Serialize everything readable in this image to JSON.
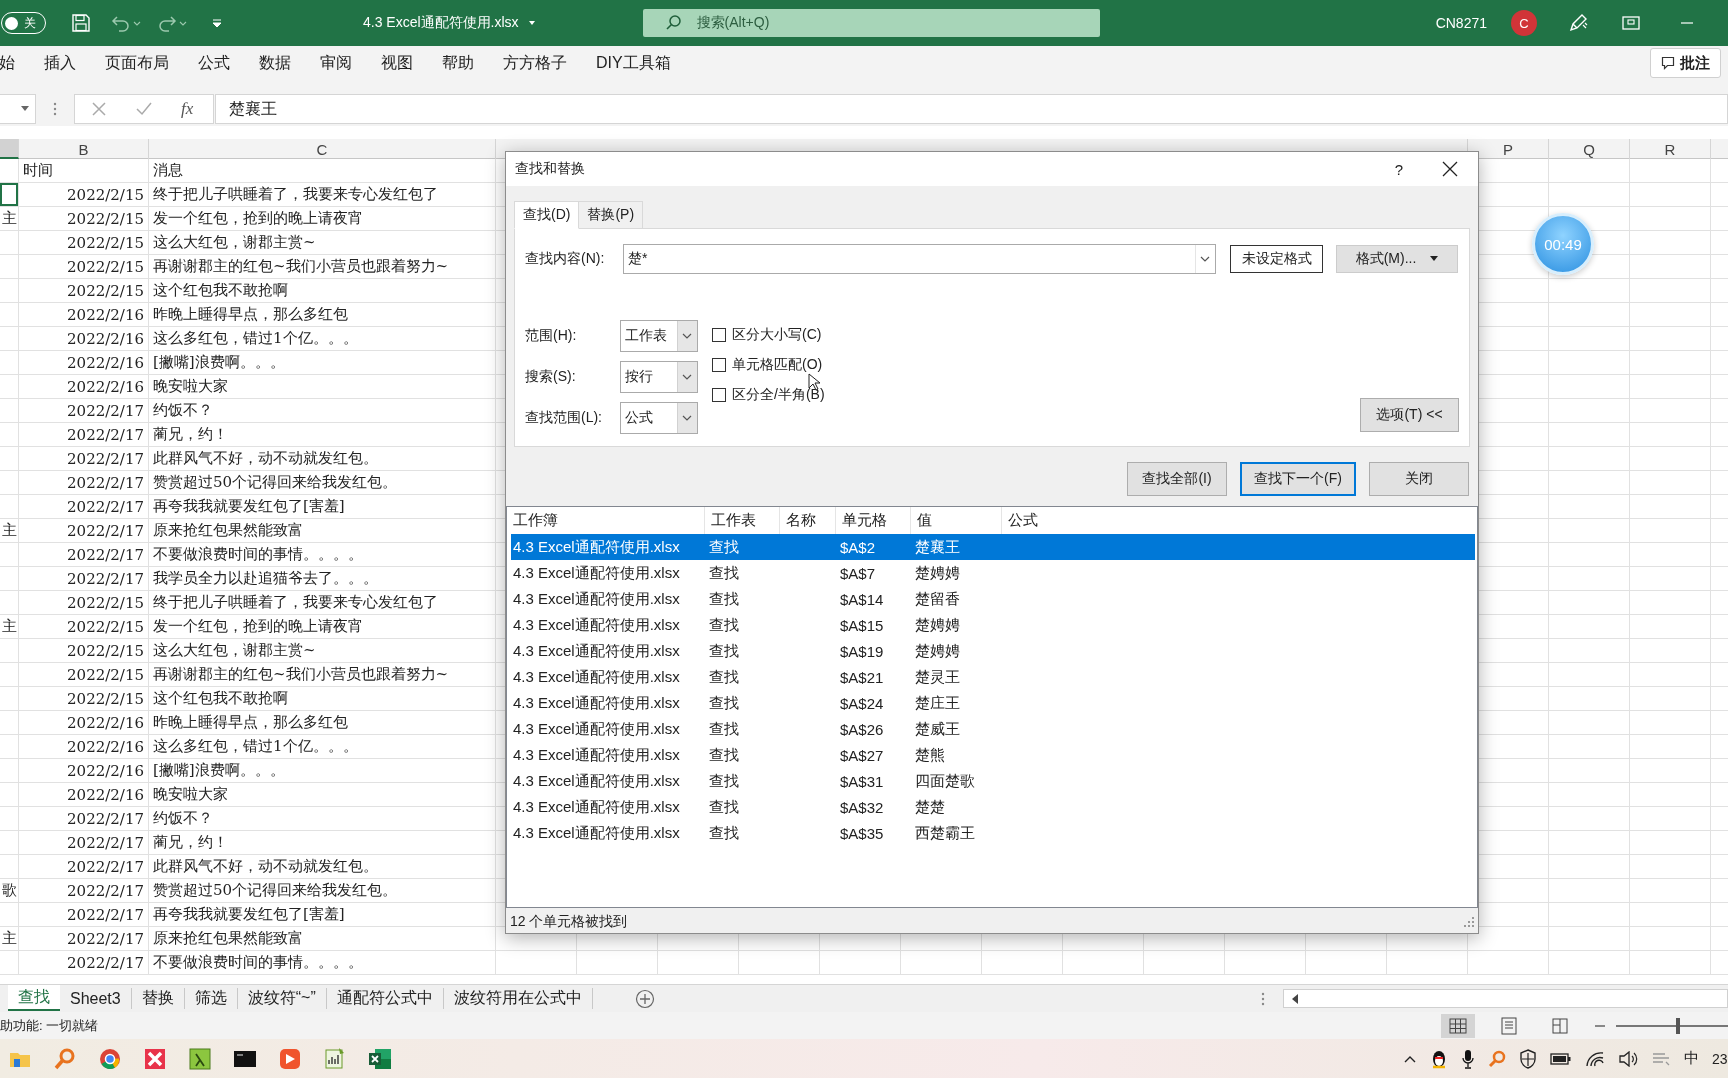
{
  "title_bar": {
    "autosave_label": "关",
    "autosave_on": false,
    "file_title": "4.3 Excel通配符使用.xlsx",
    "search_placeholder": "搜索(Alt+Q)",
    "account": "CN8271",
    "avatar_initial": "C"
  },
  "ribbon_tabs": [
    "始",
    "插入",
    "页面布局",
    "公式",
    "数据",
    "审阅",
    "视图",
    "帮助",
    "方方格子",
    "DIY工具箱"
  ],
  "comment_button": "批注",
  "formula_bar": {
    "function_label": "fx",
    "value": "楚襄王"
  },
  "sheet": {
    "column_headers": [
      "B",
      "C",
      "P",
      "Q",
      "R"
    ],
    "header_row": {
      "time": "时间",
      "message": "消息"
    },
    "rows": [
      {
        "time": "2022/2/15",
        "message": "终于把儿子哄睡着了，我要来专心发红包了",
        "selected": true
      },
      {
        "column_a": "主",
        "time": "2022/2/15",
        "message": "发一个红包，抢到的晚上请夜宵",
        "selected": false
      },
      {
        "time": "2022/2/15",
        "message": "这么大红包，谢郡主赏~",
        "selected": false
      },
      {
        "time": "2022/2/15",
        "message": "再谢谢郡主的红包~我们小营员也跟着努力~",
        "selected": false
      },
      {
        "time": "2022/2/15",
        "message": "这个红包我不敢抢啊",
        "selected": false
      },
      {
        "time": "2022/2/16",
        "message": "昨晚上睡得早点，那么多红包",
        "selected": false
      },
      {
        "time": "2022/2/16",
        "message": "这么多红包，错过1个亿。。。",
        "selected": false
      },
      {
        "time": "2022/2/16",
        "message": "[撇嘴]浪费啊。。。",
        "selected": false
      },
      {
        "time": "2022/2/16",
        "message": "晚安啦大家",
        "selected": false
      },
      {
        "time": "2022/2/17",
        "message": "约饭不？",
        "selected": false
      },
      {
        "time": "2022/2/17",
        "message": "蔺兄，约！",
        "selected": false
      },
      {
        "time": "2022/2/17",
        "message": "此群风气不好，动不动就发红包。",
        "selected": false
      },
      {
        "time": "2022/2/17",
        "message": "赞赏超过50个记得回来给我发红包。",
        "selected": false
      },
      {
        "time": "2022/2/17",
        "message": "再夸我我就要发红包了[害羞]",
        "selected": false
      },
      {
        "column_a": "主",
        "time": "2022/2/17",
        "message": "原来抢红包果然能致富",
        "selected": false
      },
      {
        "time": "2022/2/17",
        "message": "不要做浪费时间的事情。。。。",
        "selected": false
      },
      {
        "time": "2022/2/17",
        "message": "我学员全力以赴追猫爷去了。。。",
        "selected": false
      },
      {
        "time": "2022/2/15",
        "message": "终于把儿子哄睡着了，我要来专心发红包了",
        "selected": false
      },
      {
        "column_a": "主",
        "time": "2022/2/15",
        "message": "发一个红包，抢到的晚上请夜宵",
        "selected": false
      },
      {
        "time": "2022/2/15",
        "message": "这么大红包，谢郡主赏~",
        "selected": false
      },
      {
        "time": "2022/2/15",
        "message": "再谢谢郡主的红包~我们小营员也跟着努力~",
        "selected": false
      },
      {
        "time": "2022/2/15",
        "message": "这个红包我不敢抢啊",
        "selected": false
      },
      {
        "time": "2022/2/16",
        "message": "昨晚上睡得早点，那么多红包",
        "selected": false
      },
      {
        "time": "2022/2/16",
        "message": "这么多红包，错过1个亿。。。",
        "selected": false
      },
      {
        "time": "2022/2/16",
        "message": "[撇嘴]浪费啊。。。",
        "selected": false
      },
      {
        "time": "2022/2/16",
        "message": "晚安啦大家",
        "selected": false
      },
      {
        "time": "2022/2/17",
        "message": "约饭不？",
        "selected": false
      },
      {
        "time": "2022/2/17",
        "message": "蔺兄，约！",
        "selected": false
      },
      {
        "time": "2022/2/17",
        "message": "此群风气不好，动不动就发红包。",
        "selected": false
      },
      {
        "column_a": "歌",
        "time": "2022/2/17",
        "message": "赞赏超过50个记得回来给我发红包。",
        "selected": false
      },
      {
        "time": "2022/2/17",
        "message": "再夸我我就要发红包了[害羞]",
        "selected": false
      },
      {
        "column_a": "主",
        "time": "2022/2/17",
        "message": "原来抢红包果然能致富",
        "selected": false
      },
      {
        "time": "2022/2/17",
        "message": "不要做浪费时间的事情。。。。",
        "selected": false
      }
    ]
  },
  "timer": "00:49",
  "dialog": {
    "title": "查找和替换",
    "help": "?",
    "tabs": [
      {
        "label": "查找(D)",
        "selected": true
      },
      {
        "label": "替换(P)",
        "selected": false
      }
    ],
    "find_label": "查找内容(N):",
    "find_value": "楚*",
    "format_state": "未设定格式",
    "format_button": "格式(M)...",
    "options": [
      {
        "label": "范围(H):",
        "value": "工作表"
      },
      {
        "label": "搜索(S):",
        "value": "按行"
      },
      {
        "label": "查找范围(L):",
        "value": "公式"
      }
    ],
    "checkboxes": [
      {
        "label": "区分大小写(C)",
        "checked": false
      },
      {
        "label": "单元格匹配(O)",
        "checked": false
      },
      {
        "label": "区分全/半角(B)",
        "checked": false
      }
    ],
    "options_button": "选项(T) <<",
    "buttons": [
      {
        "label": "查找全部(I)",
        "default": false
      },
      {
        "label": "查找下一个(F)",
        "default": true
      },
      {
        "label": "关闭",
        "default": false
      }
    ],
    "results": {
      "columns": [
        "工作簿",
        "工作表",
        "名称",
        "单元格",
        "值",
        "公式"
      ],
      "rows": [
        {
          "workbook": "4.3 Excel通配符使用.xlsx",
          "sheet": "查找",
          "cell": "$A$2",
          "value": "楚襄王",
          "selected": true
        },
        {
          "workbook": "4.3 Excel通配符使用.xlsx",
          "sheet": "查找",
          "cell": "$A$7",
          "value": "楚娉娉",
          "selected": false
        },
        {
          "workbook": "4.3 Excel通配符使用.xlsx",
          "sheet": "查找",
          "cell": "$A$14",
          "value": "楚留香",
          "selected": false
        },
        {
          "workbook": "4.3 Excel通配符使用.xlsx",
          "sheet": "查找",
          "cell": "$A$15",
          "value": "楚娉娉",
          "selected": false
        },
        {
          "workbook": "4.3 Excel通配符使用.xlsx",
          "sheet": "查找",
          "cell": "$A$19",
          "value": "楚娉娉",
          "selected": false
        },
        {
          "workbook": "4.3 Excel通配符使用.xlsx",
          "sheet": "查找",
          "cell": "$A$21",
          "value": "楚灵王",
          "selected": false
        },
        {
          "workbook": "4.3 Excel通配符使用.xlsx",
          "sheet": "查找",
          "cell": "$A$24",
          "value": "楚庄王",
          "selected": false
        },
        {
          "workbook": "4.3 Excel通配符使用.xlsx",
          "sheet": "查找",
          "cell": "$A$26",
          "value": "楚威王",
          "selected": false
        },
        {
          "workbook": "4.3 Excel通配符使用.xlsx",
          "sheet": "查找",
          "cell": "$A$27",
          "value": "楚熊",
          "selected": false
        },
        {
          "workbook": "4.3 Excel通配符使用.xlsx",
          "sheet": "查找",
          "cell": "$A$31",
          "value": "四面楚歌",
          "selected": false
        },
        {
          "workbook": "4.3 Excel通配符使用.xlsx",
          "sheet": "查找",
          "cell": "$A$32",
          "value": "楚楚",
          "selected": false
        },
        {
          "workbook": "4.3 Excel通配符使用.xlsx",
          "sheet": "查找",
          "cell": "$A$35",
          "value": "西楚霸王",
          "selected": false
        }
      ]
    },
    "status": "12 个单元格被找到"
  },
  "sheet_tabs": [
    {
      "label": "查找",
      "selected": true
    },
    {
      "label": "Sheet3",
      "selected": false
    },
    {
      "label": "替换",
      "selected": false
    },
    {
      "label": "筛选",
      "selected": false
    },
    {
      "label": "波纹符“~”",
      "selected": false
    },
    {
      "label": "通配符公式中",
      "selected": false
    },
    {
      "label": "波纹符用在公式中",
      "selected": false
    }
  ],
  "status_bar": {
    "text": "助功能: 一切就绪",
    "zoom_slider": {
      "level": 0.55
    }
  },
  "taskbar": {
    "ime_label": "中",
    "clock": "23"
  }
}
